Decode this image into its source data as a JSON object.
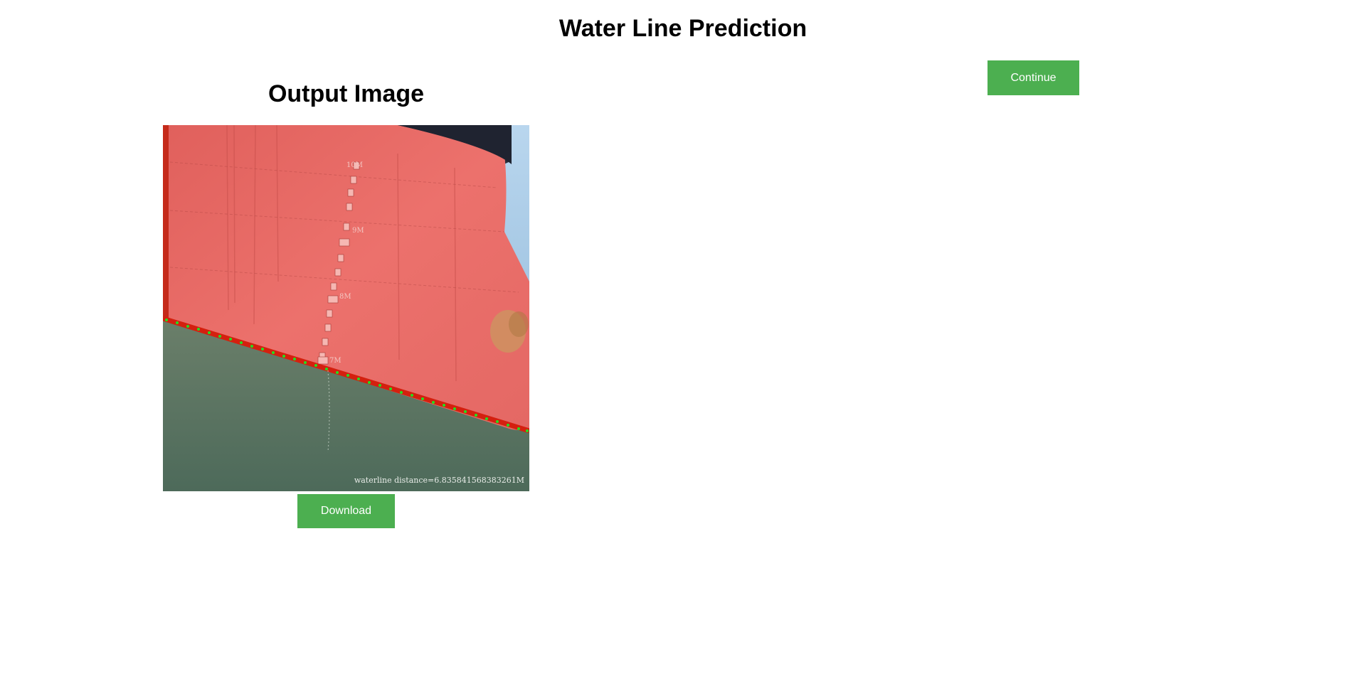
{
  "header": {
    "title": "Water Line Prediction"
  },
  "actions": {
    "continue_label": "Continue",
    "download_label": "Download"
  },
  "output": {
    "heading": "Output Image",
    "image_overlay_text": "waterline distance=6.835841568383261M",
    "draft_marks": [
      "10M",
      "9M",
      "8M",
      "7M"
    ]
  },
  "colors": {
    "button_green": "#4caf50",
    "hull_red": "#e96a66",
    "water": "#5f7a64",
    "waterline_points": "#22e022"
  }
}
